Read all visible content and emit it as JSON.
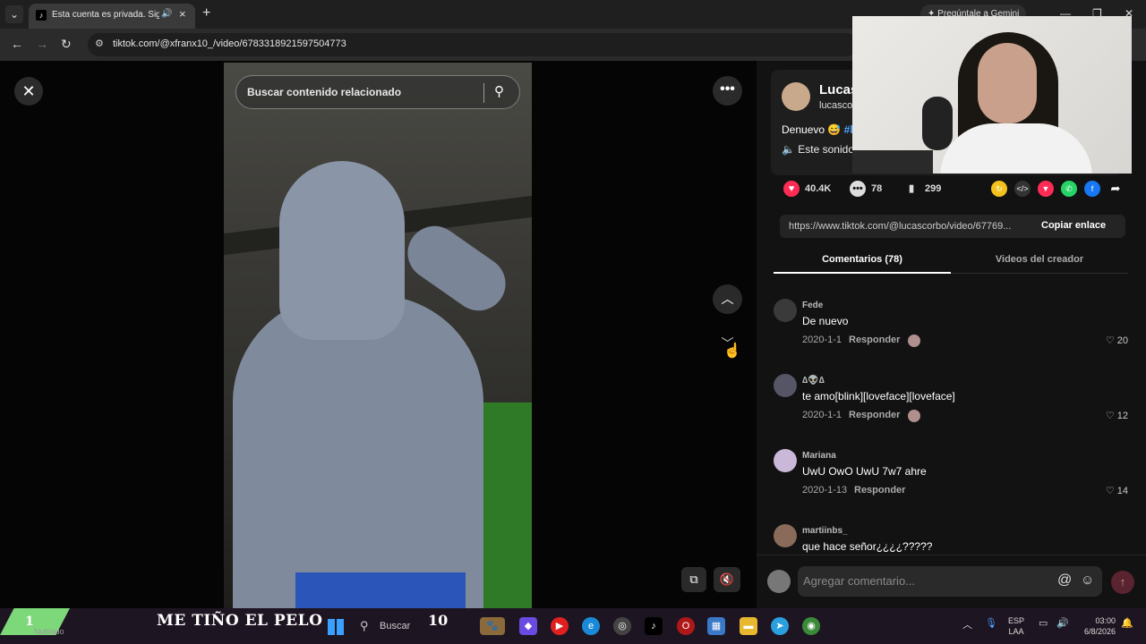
{
  "browser": {
    "tab_title": "Esta cuenta es privada. Sig",
    "new_tab": "+",
    "gemini": "Pregúntale a Gemini",
    "url": "tiktok.com/@xfranx10_/video/6783318921597504773"
  },
  "player": {
    "search_placeholder": "Buscar contenido relacionado"
  },
  "creator": {
    "name": "Lucas",
    "handle": "lucasco",
    "description": "Denuevo 😅 ",
    "hashtag": "#l",
    "sound": "Este sonido"
  },
  "stats": {
    "likes": "40.4K",
    "comments": "78",
    "saves": "299"
  },
  "share_link": {
    "url": "https://www.tiktok.com/@lucascorbo/video/67769...",
    "copy_label": "Copiar enlace"
  },
  "tabs": {
    "comments": "Comentarios (78)",
    "creator_videos": "Videos del creador"
  },
  "comments": [
    {
      "user": "Fede",
      "text": "De nuevo",
      "date": "2020-1-1",
      "reply": "Responder",
      "likes": "20"
    },
    {
      "user": "∆👽∆",
      "text": "te amo[blink][loveface][loveface]",
      "date": "2020-1-1",
      "reply": "Responder",
      "likes": "12"
    },
    {
      "user": "Mariana",
      "text": "UwU OwO UwU 7w7 ahre",
      "date": "2020-1-13",
      "reply": "Responder",
      "likes": "14"
    },
    {
      "user": "martiinbs_",
      "text": "que hace señor¿¿¿¿?????",
      "date": "",
      "reply": "",
      "likes": ""
    }
  ],
  "compose": {
    "placeholder": "Agregar comentario..."
  },
  "taskbar": {
    "badge": "1",
    "weather": "Nublado",
    "overlay_text": "ME TIÑO EL PELO",
    "search": "Buscar",
    "overlay_num": "10",
    "lang_top": "ESP",
    "lang_bottom": "LAA",
    "time": "03:00",
    "date": "6/8/2026"
  },
  "colors": {
    "like": "#fe2c55",
    "accent_blue": "#4fa3ff",
    "taskbar_bg": "#1e1522",
    "badge_green": "#7dd87a"
  }
}
